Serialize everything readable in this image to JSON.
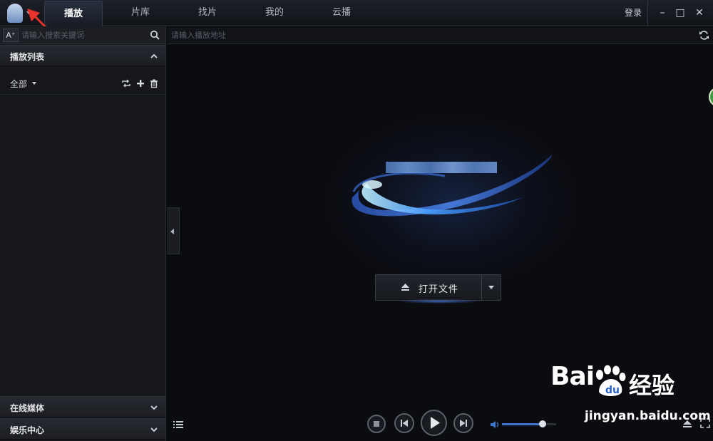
{
  "titlebar": {
    "tabs": [
      {
        "label": "播放",
        "active": true
      },
      {
        "label": "片库",
        "active": false
      },
      {
        "label": "找片",
        "active": false
      },
      {
        "label": "我的",
        "active": false
      },
      {
        "label": "云播",
        "active": false
      }
    ],
    "login_label": "登录",
    "minimize_glyph": "–",
    "maximize_glyph": "□",
    "close_glyph": "✕"
  },
  "sidebar": {
    "font_button_label": "A⁺",
    "search_placeholder": "请输入搜索关键词",
    "playlist_title": "播放列表",
    "filter_label": "全部",
    "online_media_title": "在线媒体",
    "entertainment_title": "娱乐中心"
  },
  "main": {
    "url_placeholder": "请输入播放地址",
    "open_file_label": "打开文件"
  },
  "player": {
    "volume_level": 0.75
  },
  "watermark": {
    "brand_text": "Bai",
    "brand_text2": "经验",
    "url": "jingyan.baidu.com"
  },
  "colors": {
    "accent_blue": "#3f78d2",
    "annotation_red": "#e8332a",
    "background": "#0b0c10"
  }
}
